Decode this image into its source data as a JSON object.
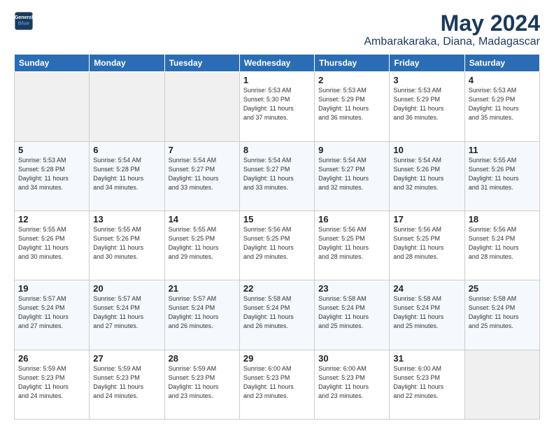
{
  "header": {
    "logo_line1": "General",
    "logo_line2": "Blue",
    "title": "May 2024",
    "subtitle": "Ambarakaraka, Diana, Madagascar"
  },
  "weekdays": [
    "Sunday",
    "Monday",
    "Tuesday",
    "Wednesday",
    "Thursday",
    "Friday",
    "Saturday"
  ],
  "weeks": [
    [
      {
        "day": "",
        "info": ""
      },
      {
        "day": "",
        "info": ""
      },
      {
        "day": "",
        "info": ""
      },
      {
        "day": "1",
        "info": "Sunrise: 5:53 AM\nSunset: 5:30 PM\nDaylight: 11 hours\nand 37 minutes."
      },
      {
        "day": "2",
        "info": "Sunrise: 5:53 AM\nSunset: 5:29 PM\nDaylight: 11 hours\nand 36 minutes."
      },
      {
        "day": "3",
        "info": "Sunrise: 5:53 AM\nSunset: 5:29 PM\nDaylight: 11 hours\nand 36 minutes."
      },
      {
        "day": "4",
        "info": "Sunrise: 5:53 AM\nSunset: 5:29 PM\nDaylight: 11 hours\nand 35 minutes."
      }
    ],
    [
      {
        "day": "5",
        "info": "Sunrise: 5:53 AM\nSunset: 5:28 PM\nDaylight: 11 hours\nand 34 minutes."
      },
      {
        "day": "6",
        "info": "Sunrise: 5:54 AM\nSunset: 5:28 PM\nDaylight: 11 hours\nand 34 minutes."
      },
      {
        "day": "7",
        "info": "Sunrise: 5:54 AM\nSunset: 5:27 PM\nDaylight: 11 hours\nand 33 minutes."
      },
      {
        "day": "8",
        "info": "Sunrise: 5:54 AM\nSunset: 5:27 PM\nDaylight: 11 hours\nand 33 minutes."
      },
      {
        "day": "9",
        "info": "Sunrise: 5:54 AM\nSunset: 5:27 PM\nDaylight: 11 hours\nand 32 minutes."
      },
      {
        "day": "10",
        "info": "Sunrise: 5:54 AM\nSunset: 5:26 PM\nDaylight: 11 hours\nand 32 minutes."
      },
      {
        "day": "11",
        "info": "Sunrise: 5:55 AM\nSunset: 5:26 PM\nDaylight: 11 hours\nand 31 minutes."
      }
    ],
    [
      {
        "day": "12",
        "info": "Sunrise: 5:55 AM\nSunset: 5:26 PM\nDaylight: 11 hours\nand 30 minutes."
      },
      {
        "day": "13",
        "info": "Sunrise: 5:55 AM\nSunset: 5:26 PM\nDaylight: 11 hours\nand 30 minutes."
      },
      {
        "day": "14",
        "info": "Sunrise: 5:55 AM\nSunset: 5:25 PM\nDaylight: 11 hours\nand 29 minutes."
      },
      {
        "day": "15",
        "info": "Sunrise: 5:56 AM\nSunset: 5:25 PM\nDaylight: 11 hours\nand 29 minutes."
      },
      {
        "day": "16",
        "info": "Sunrise: 5:56 AM\nSunset: 5:25 PM\nDaylight: 11 hours\nand 28 minutes."
      },
      {
        "day": "17",
        "info": "Sunrise: 5:56 AM\nSunset: 5:25 PM\nDaylight: 11 hours\nand 28 minutes."
      },
      {
        "day": "18",
        "info": "Sunrise: 5:56 AM\nSunset: 5:24 PM\nDaylight: 11 hours\nand 28 minutes."
      }
    ],
    [
      {
        "day": "19",
        "info": "Sunrise: 5:57 AM\nSunset: 5:24 PM\nDaylight: 11 hours\nand 27 minutes."
      },
      {
        "day": "20",
        "info": "Sunrise: 5:57 AM\nSunset: 5:24 PM\nDaylight: 11 hours\nand 27 minutes."
      },
      {
        "day": "21",
        "info": "Sunrise: 5:57 AM\nSunset: 5:24 PM\nDaylight: 11 hours\nand 26 minutes."
      },
      {
        "day": "22",
        "info": "Sunrise: 5:58 AM\nSunset: 5:24 PM\nDaylight: 11 hours\nand 26 minutes."
      },
      {
        "day": "23",
        "info": "Sunrise: 5:58 AM\nSunset: 5:24 PM\nDaylight: 11 hours\nand 25 minutes."
      },
      {
        "day": "24",
        "info": "Sunrise: 5:58 AM\nSunset: 5:24 PM\nDaylight: 11 hours\nand 25 minutes."
      },
      {
        "day": "25",
        "info": "Sunrise: 5:58 AM\nSunset: 5:24 PM\nDaylight: 11 hours\nand 25 minutes."
      }
    ],
    [
      {
        "day": "26",
        "info": "Sunrise: 5:59 AM\nSunset: 5:23 PM\nDaylight: 11 hours\nand 24 minutes."
      },
      {
        "day": "27",
        "info": "Sunrise: 5:59 AM\nSunset: 5:23 PM\nDaylight: 11 hours\nand 24 minutes."
      },
      {
        "day": "28",
        "info": "Sunrise: 5:59 AM\nSunset: 5:23 PM\nDaylight: 11 hours\nand 23 minutes."
      },
      {
        "day": "29",
        "info": "Sunrise: 6:00 AM\nSunset: 5:23 PM\nDaylight: 11 hours\nand 23 minutes."
      },
      {
        "day": "30",
        "info": "Sunrise: 6:00 AM\nSunset: 5:23 PM\nDaylight: 11 hours\nand 23 minutes."
      },
      {
        "day": "31",
        "info": "Sunrise: 6:00 AM\nSunset: 5:23 PM\nDaylight: 11 hours\nand 22 minutes."
      },
      {
        "day": "",
        "info": ""
      }
    ]
  ]
}
